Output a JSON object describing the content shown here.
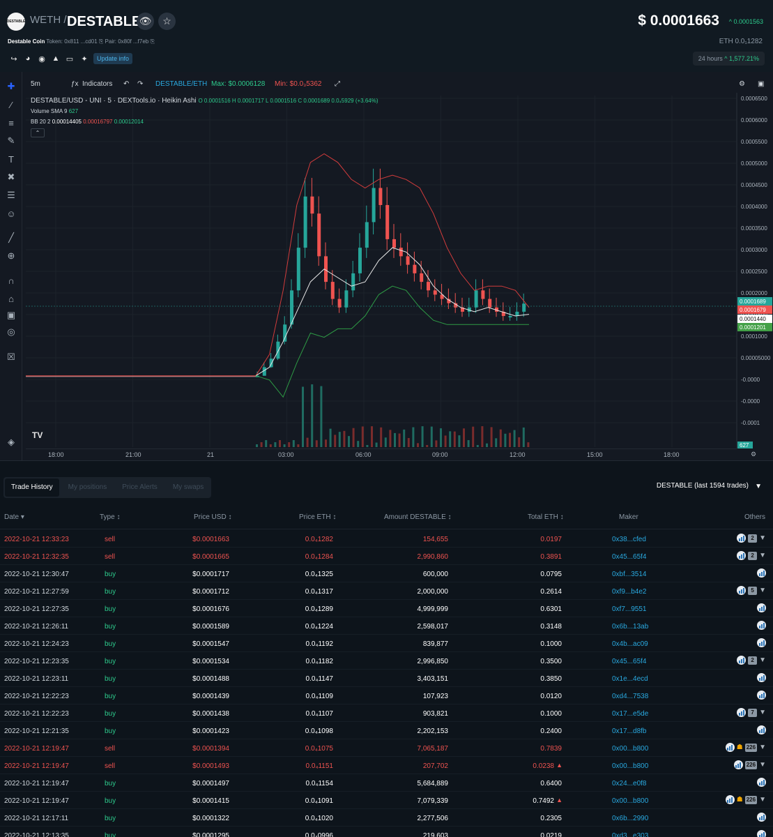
{
  "header": {
    "logo_text": "DESTABLE",
    "quote_symbol": "WETH",
    "separator": "/",
    "base_symbol": "DESTABLE",
    "token_name": "Destable Coin",
    "token_label": "Token: 0x811 ...cd01",
    "pair_label": "Pair: 0x80f ...f7eb",
    "update_button": "Update info",
    "price_usd": "$ 0.0001663",
    "price_change": "^ 0.0001563",
    "price_eth": "ETH  0.0₁1282",
    "period_label": "24 hours",
    "period_change": "^ 1,577.21%"
  },
  "chart_toolbar": {
    "interval": "5m",
    "indicators": "Indicators",
    "pair": "DESTABLE/ETH",
    "max": "Max: $0.0006128",
    "min": "Min: $0.0₃5362"
  },
  "legend": {
    "title": "DESTABLE/USD - UNI · 5 · DEXTools.io · Heikin Ashi",
    "ohlc": "O 0.0001516  H 0.0001717  L 0.0001516  C 0.0001689  0.0₄5929 (+3.64%)",
    "volume": "Volume SMA 9",
    "volume_value": "627",
    "bb_label": "BB 20 2",
    "bb_mid": "0.00014405",
    "bb_upper": "0.00016797",
    "bb_lower": "0.00012014"
  },
  "chart_data": {
    "type": "candlestick",
    "price_ticks": [
      "0.0006500",
      "0.0006000",
      "0.0005500",
      "0.0005000",
      "0.0004500",
      "0.0004000",
      "0.0003500",
      "0.0003000",
      "0.0002500",
      "0.0002000",
      "0.0001500",
      "0.0001000",
      "0.00005000",
      "-0.0000",
      "-0.0000",
      "-0.0001"
    ],
    "price_axis_range": [
      -0.00011,
      0.00065
    ],
    "time_ticks": [
      "18:00",
      "21:00",
      "21",
      "03:00",
      "06:00",
      "09:00",
      "12:00",
      "15:00",
      "18:00"
    ],
    "price_labels": [
      {
        "text": "0.0001689",
        "color": "#26a69a"
      },
      {
        "text": "0.0001679",
        "color": "#ef5350"
      },
      {
        "text": "0.0001440",
        "color": "#ffffff"
      },
      {
        "text": "0.0001201",
        "color": "#43a047"
      }
    ],
    "volume_label": "627",
    "series": {
      "candles_close": [
        0.0,
        2e-05,
        4e-05,
        8e-05,
        0.00012,
        0.0002,
        0.0003,
        0.00042,
        0.00038,
        0.00028,
        0.00022,
        0.00018,
        0.00016,
        0.0002,
        0.00024,
        0.0003,
        0.00036,
        0.00044,
        0.0004,
        0.00032,
        0.0003,
        0.00028,
        0.00026,
        0.00024,
        0.00022,
        0.0002,
        0.00019,
        0.00018,
        0.00017,
        0.00016,
        0.00015,
        0.00016,
        0.0002,
        0.00018,
        0.00016,
        0.00015,
        0.00014,
        0.00014,
        0.00015,
        0.000169
      ],
      "bb_upper": [
        0.0,
        5e-05,
        0.0002,
        0.0004,
        0.0005,
        0.00052,
        0.0005,
        0.00046,
        0.00044,
        0.00046,
        0.00047,
        0.00046,
        0.00044,
        0.00038,
        0.0003,
        0.00024,
        0.0002,
        0.00021,
        0.00021,
        0.0002,
        0.00016
      ],
      "bb_mid": [
        0.0,
        2e-05,
        8e-05,
        0.00015,
        0.00022,
        0.00025,
        0.00023,
        0.00021,
        0.00022,
        0.00027,
        0.0003,
        0.00029,
        0.00026,
        0.00021,
        0.00018,
        0.00016,
        0.00015,
        0.00016,
        0.00015,
        0.00014,
        0.000144
      ],
      "bb_lower": [
        0.0,
        -1e-05,
        -5e-05,
        3e-05,
        0.0001,
        9e-05,
        0.00011,
        0.00011,
        0.00014,
        0.00019,
        0.00021,
        0.0002,
        0.00016,
        0.00013,
        0.00012,
        0.00012,
        0.00012,
        0.00012,
        0.00012,
        0.00012,
        0.00012
      ]
    }
  },
  "tabs": [
    "Trade History",
    "My positions",
    "Price Alerts",
    "My swaps"
  ],
  "trades_info": "DESTABLE (last 1594 trades)",
  "columns": [
    "Date",
    "Type",
    "Price USD",
    "Price ETH",
    "Amount DESTABLE",
    "Total ETH",
    "Maker",
    "Others"
  ],
  "rows": [
    {
      "date": "2022-10-21 12:33:23",
      "type": "sell",
      "usd": "$0.0001663",
      "eth": "0.0₄1282",
      "amount": "154,655",
      "total": "0.0197",
      "maker": "0x38...cfed",
      "badge": "2",
      "bank": false,
      "bot": false
    },
    {
      "date": "2022-10-21 12:32:35",
      "type": "sell",
      "usd": "$0.0001665",
      "eth": "0.0₄1284",
      "amount": "2,990,860",
      "total": "0.3891",
      "maker": "0x45...65f4",
      "badge": "2",
      "bank": false,
      "bot": false
    },
    {
      "date": "2022-10-21 12:30:47",
      "type": "buy",
      "usd": "$0.0001717",
      "eth": "0.0₄1325",
      "amount": "600,000",
      "total": "0.0795",
      "maker": "0xbf...3514",
      "badge": "",
      "bank": false,
      "bot": false
    },
    {
      "date": "2022-10-21 12:27:59",
      "type": "buy",
      "usd": "$0.0001712",
      "eth": "0.0₄1317",
      "amount": "2,000,000",
      "total": "0.2614",
      "maker": "0xf9...b4e2",
      "badge": "5",
      "bank": false,
      "bot": false
    },
    {
      "date": "2022-10-21 12:27:35",
      "type": "buy",
      "usd": "$0.0001676",
      "eth": "0.0₄1289",
      "amount": "4,999,999",
      "total": "0.6301",
      "maker": "0xf7...9551",
      "badge": "",
      "bank": false,
      "bot": false
    },
    {
      "date": "2022-10-21 12:26:11",
      "type": "buy",
      "usd": "$0.0001589",
      "eth": "0.0₄1224",
      "amount": "2,598,017",
      "total": "0.3148",
      "maker": "0x6b...13ab",
      "badge": "",
      "bank": false,
      "bot": false
    },
    {
      "date": "2022-10-21 12:24:23",
      "type": "buy",
      "usd": "$0.0001547",
      "eth": "0.0₄1192",
      "amount": "839,877",
      "total": "0.1000",
      "maker": "0x4b...ac09",
      "badge": "",
      "bank": false,
      "bot": false
    },
    {
      "date": "2022-10-21 12:23:35",
      "type": "buy",
      "usd": "$0.0001534",
      "eth": "0.0₄1182",
      "amount": "2,996,850",
      "total": "0.3500",
      "maker": "0x45...65f4",
      "badge": "2",
      "bank": false,
      "bot": false
    },
    {
      "date": "2022-10-21 12:23:11",
      "type": "buy",
      "usd": "$0.0001488",
      "eth": "0.0₄1147",
      "amount": "3,403,151",
      "total": "0.3850",
      "maker": "0x1e...4ecd",
      "badge": "",
      "bank": false,
      "bot": false
    },
    {
      "date": "2022-10-21 12:22:23",
      "type": "buy",
      "usd": "$0.0001439",
      "eth": "0.0₄1109",
      "amount": "107,923",
      "total": "0.0120",
      "maker": "0xd4...7538",
      "badge": "",
      "bank": false,
      "bot": false
    },
    {
      "date": "2022-10-21 12:22:23",
      "type": "buy",
      "usd": "$0.0001438",
      "eth": "0.0₄1107",
      "amount": "903,821",
      "total": "0.1000",
      "maker": "0x17...e5de",
      "badge": "7",
      "bank": false,
      "bot": false
    },
    {
      "date": "2022-10-21 12:21:35",
      "type": "buy",
      "usd": "$0.0001423",
      "eth": "0.0₄1098",
      "amount": "2,202,153",
      "total": "0.2400",
      "maker": "0x17...d8fb",
      "badge": "",
      "bank": false,
      "bot": false
    },
    {
      "date": "2022-10-21 12:19:47",
      "type": "sell",
      "usd": "$0.0001394",
      "eth": "0.0₄1075",
      "amount": "7,065,187",
      "total": "0.7839",
      "maker": "0x00...b800",
      "badge": "226",
      "bank": true,
      "bot": false
    },
    {
      "date": "2022-10-21 12:19:47",
      "type": "sell",
      "usd": "$0.0001493",
      "eth": "0.0₄1151",
      "amount": "207,702",
      "total": "0.0238",
      "maker": "0x00...b800",
      "badge": "226",
      "bank": false,
      "bot": true
    },
    {
      "date": "2022-10-21 12:19:47",
      "type": "buy",
      "usd": "$0.0001497",
      "eth": "0.0₄1154",
      "amount": "5,684,889",
      "total": "0.6400",
      "maker": "0x24...e0f8",
      "badge": "",
      "bank": false,
      "bot": false
    },
    {
      "date": "2022-10-21 12:19:47",
      "type": "buy",
      "usd": "$0.0001415",
      "eth": "0.0₄1091",
      "amount": "7,079,339",
      "total": "0.7492",
      "maker": "0x00...b800",
      "badge": "226",
      "bank": true,
      "bot": true
    },
    {
      "date": "2022-10-21 12:17:11",
      "type": "buy",
      "usd": "$0.0001322",
      "eth": "0.0₄1020",
      "amount": "2,277,506",
      "total": "0.2305",
      "maker": "0x6b...2990",
      "badge": "",
      "bank": false,
      "bot": false
    },
    {
      "date": "2022-10-21 12:13:35",
      "type": "buy",
      "usd": "$0.0001295",
      "eth": "0.0₄0996",
      "amount": "219,603",
      "total": "0.0219",
      "maker": "0xd3...e303",
      "badge": "",
      "bank": false,
      "bot": false
    }
  ]
}
